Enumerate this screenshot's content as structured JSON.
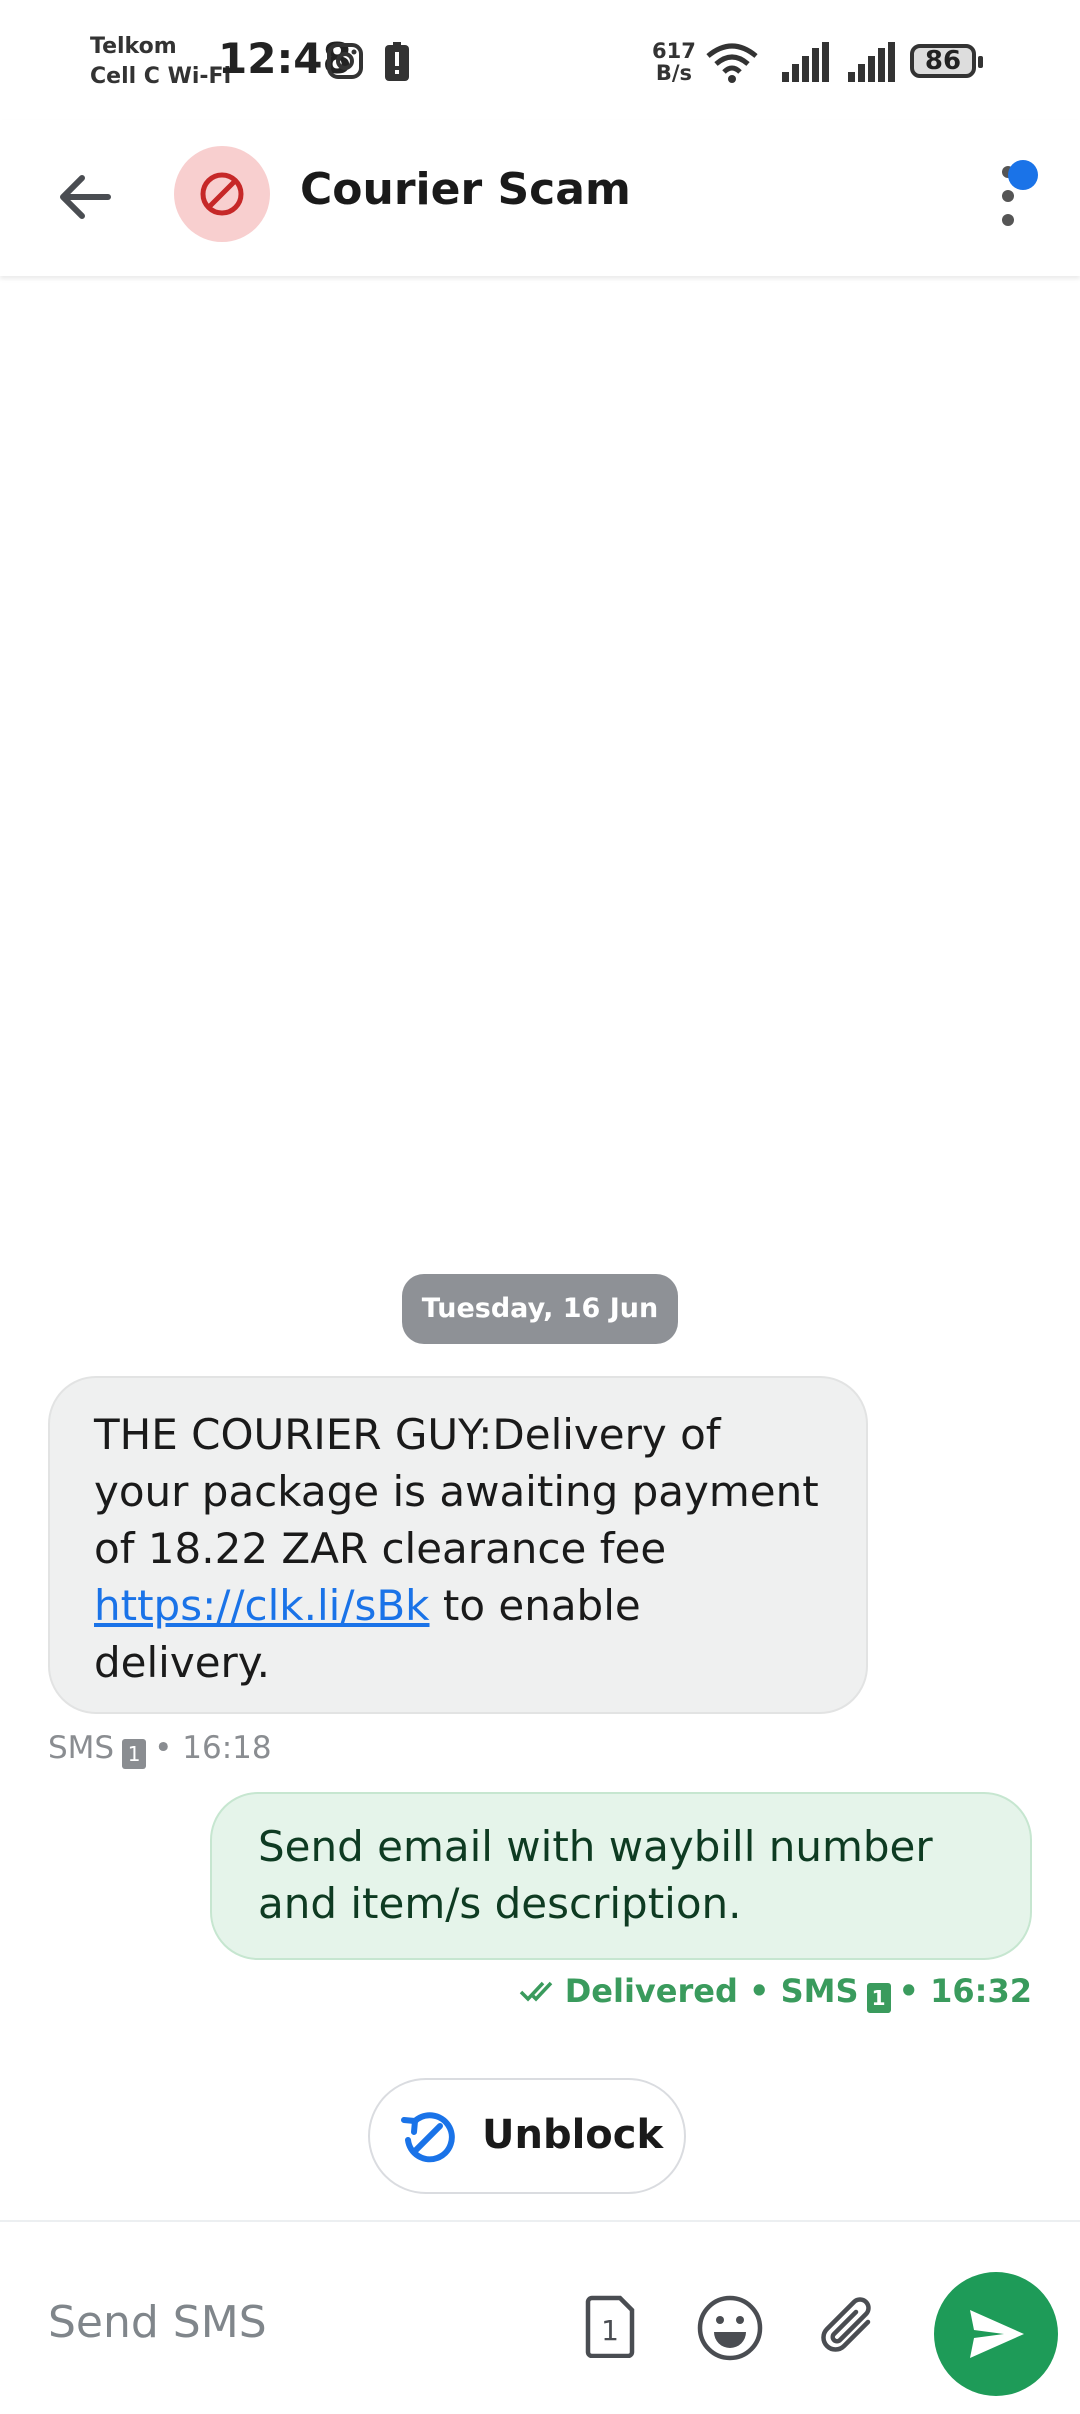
{
  "status_bar": {
    "carrier_line1": "Telkom",
    "carrier_line2": "Cell C Wi-Fi",
    "time": "12:48",
    "net_speed_value": "617",
    "net_speed_unit": "B/s",
    "battery": "86"
  },
  "toolbar": {
    "contact_name": "Courier Scam",
    "avatar_icon": "blocked-icon"
  },
  "conversation": {
    "date_divider": "Tuesday, 16 Jun",
    "incoming": {
      "text_before_link": "THE COURIER GUY:Delivery of your package is awaiting payment of 18.22 ZAR clearance fee ",
      "link": "https://clk.li/sBk",
      "text_after_link": " to enable delivery.",
      "meta_channel": "SMS",
      "meta_sim": "1",
      "meta_time": "• 16:18"
    },
    "outgoing": {
      "text": "Send email with waybill number and item/s description.",
      "status": "Delivered",
      "meta_channel": "• SMS",
      "meta_sim": "1",
      "meta_time": "• 16:32"
    },
    "unblock_label": "Unblock"
  },
  "composer": {
    "placeholder": "Send SMS",
    "sim_indicator": "1"
  },
  "colors": {
    "accent": "#1a73e8",
    "send": "#1e9b58",
    "blocked_avatar_bg": "#f8cfcf",
    "blocked_icon": "#c62828"
  }
}
